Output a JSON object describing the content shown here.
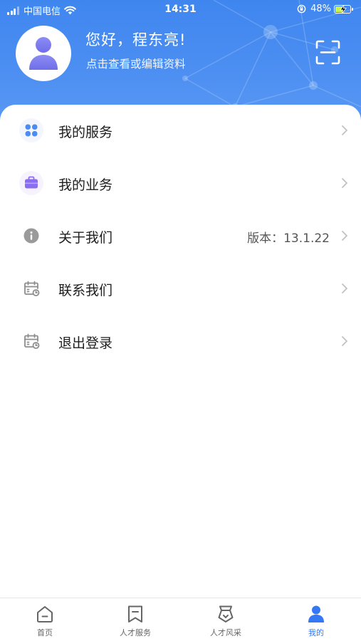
{
  "status_bar": {
    "carrier": "中国电信",
    "time": "14:31",
    "battery_percent": "48%"
  },
  "profile": {
    "greeting": "您好，程东亮!",
    "edit_hint": "点击查看或编辑资料"
  },
  "menu": {
    "items": [
      {
        "label": "我的服务",
        "value": "",
        "icon": "grid-icon"
      },
      {
        "label": "我的业务",
        "value": "",
        "icon": "briefcase-icon"
      },
      {
        "label": "关于我们",
        "value": "版本：13.1.22",
        "icon": "info-icon"
      },
      {
        "label": "联系我们",
        "value": "",
        "icon": "calendar-clock-icon"
      },
      {
        "label": "退出登录",
        "value": "",
        "icon": "calendar-clock-icon"
      }
    ]
  },
  "tabbar": {
    "tabs": [
      {
        "label": "首页",
        "icon": "home-icon"
      },
      {
        "label": "人才服务",
        "icon": "bookmark-icon"
      },
      {
        "label": "人才风采",
        "icon": "badge-icon"
      },
      {
        "label": "我的",
        "icon": "person-icon",
        "active": true
      }
    ]
  },
  "colors": {
    "header_blue": "#4a8cf1",
    "active_tab": "#3478f6",
    "purple": "#8a6df0"
  }
}
